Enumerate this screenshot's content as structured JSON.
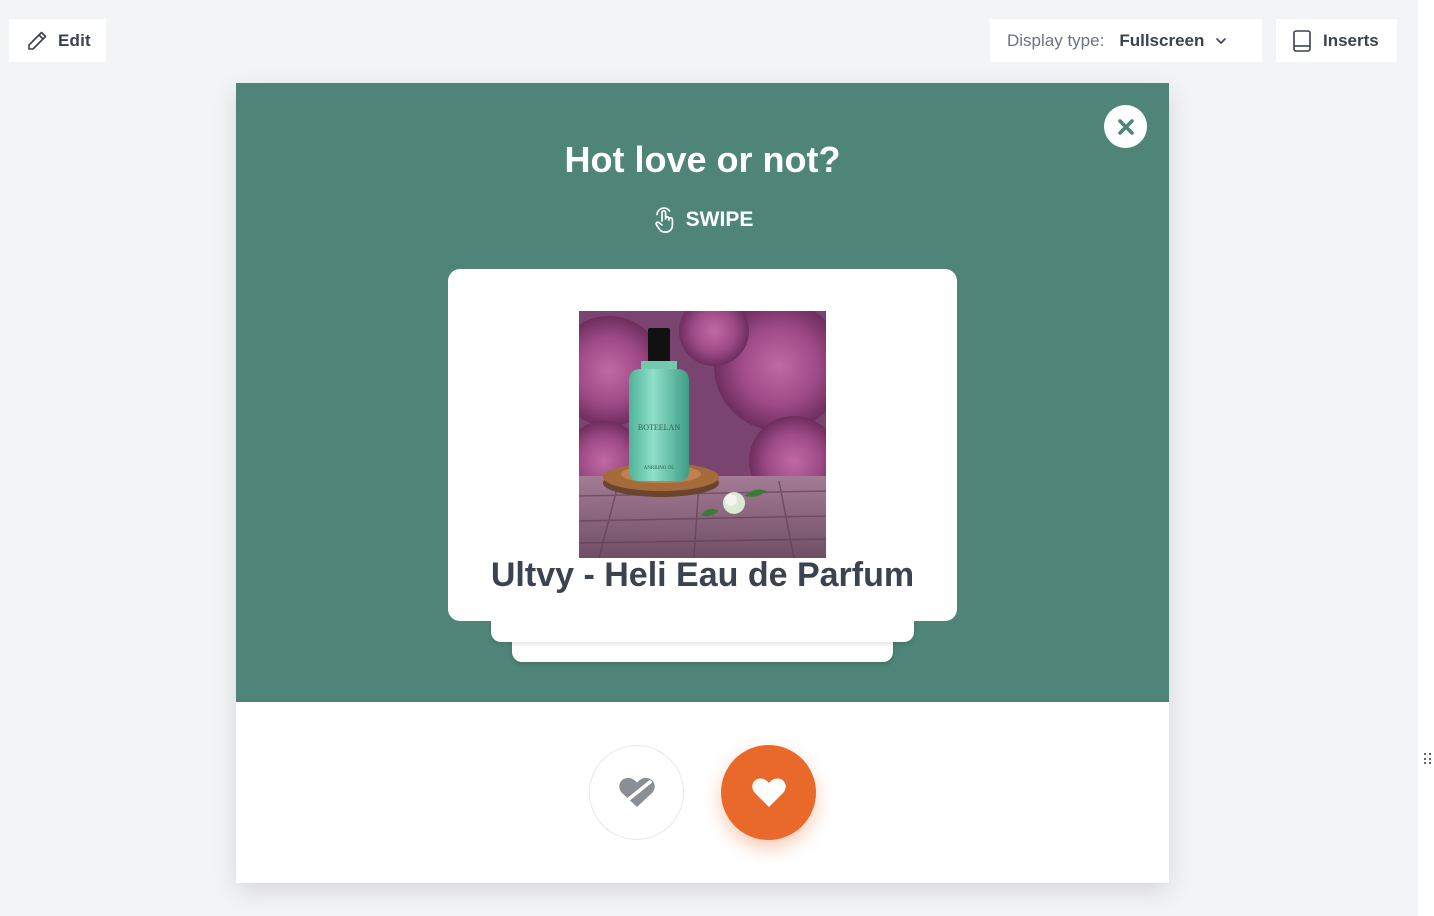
{
  "toolbar": {
    "edit_label": "Edit",
    "display_type_label": "Display type:",
    "display_type_value": "Fullscreen",
    "inserts_label": "Inserts"
  },
  "popup": {
    "title": "Hot love or not?",
    "swipe_label": "SWIPE",
    "card": {
      "product_name": "Ultvy - Heli Eau de Parfum",
      "bottle_label_line1": "BOTEELAN",
      "bottle_label_line2": "ANRBINO OL"
    },
    "colors": {
      "header_bg": "#4f8478",
      "like": "#e8692a",
      "dislike_icon": "#8a8f96",
      "text_dark": "#3b4250"
    }
  },
  "icons": {
    "edit": "pencil-icon",
    "dropdown": "chevron-down-icon",
    "inserts": "book-icon",
    "close": "close-icon",
    "swipe": "hand-pointer-icon",
    "dislike": "broken-heart-icon",
    "like": "heart-icon"
  }
}
